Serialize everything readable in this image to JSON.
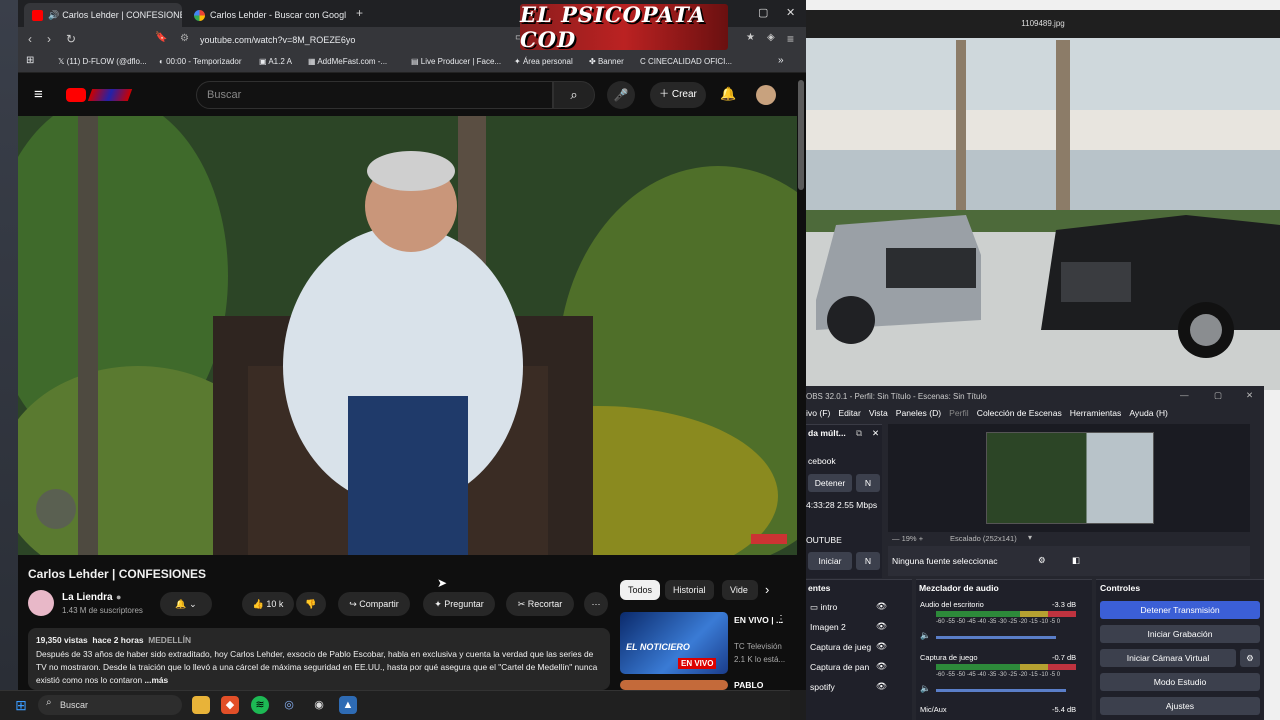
{
  "browser": {
    "tabs": [
      {
        "label": "Carlos Lehder | CONFESIONES"
      },
      {
        "label": "Carlos Lehder - Buscar con Google"
      }
    ],
    "new_tab": "+",
    "url": "youtube.com/watch?v=8M_ROEZE6yo",
    "bookmarks": [
      "(11) D-FLOW (@dflo...",
      "00:00 - Temporizador",
      "A1.2 A",
      "AddMeFast.com -...",
      "Live Producer | Face...",
      "Área personal",
      "Banner",
      "CINECALIDAD OFICI..."
    ]
  },
  "banner": {
    "text": "EL PSICOPATA COD"
  },
  "youtube": {
    "search_placeholder": "Buscar",
    "create_label": "Crear",
    "video_title": "Carlos Lehder | CONFESIONES",
    "channel_name": "La Liendra",
    "subscribers": "1.43 M de suscriptores",
    "likes": "10 k",
    "share": "Compartir",
    "ask": "Preguntar",
    "clip": "Recortar",
    "chips": [
      "Todos",
      "Historial",
      "Vide"
    ],
    "views": "19,350 vistas",
    "time_ago": "hace 2 horas",
    "location": "MEDELLÍN",
    "description": "Después de 33 años de haber sido extraditado, hoy Carlos Lehder, exsocio de Pablo Escobar, habla en exclusiva y cuenta la verdad que las series de TV no mostraron. Desde la traición que lo llevó a una cárcel de máxima seguridad en EE.UU., hasta por qué asegura que el \"Cartel de Medellín\" nunca existió como nos lo contaron",
    "more": "...más",
    "rec1": {
      "badge": "EN VIVO | ...",
      "channel": "TC Televisión",
      "views": "2.1 K lo está...",
      "thumb_text": "EL NOTICIERO",
      "live": "EN VIVO"
    },
    "rec2": {
      "title": "PABLO"
    }
  },
  "taskbar": {
    "search": "Buscar"
  },
  "viewer": {
    "title": "1109489.jpg"
  },
  "obs": {
    "title": "OBS 32.0.1 - Perfil: Sin Título - Escenas: Sin Título",
    "menu": [
      "ivo (F)",
      "Editar",
      "Vista",
      "Paneles (D)",
      "Perfil",
      "Colección de Escenas",
      "Herramientas",
      "Ayuda (H)"
    ],
    "multi_title": "da múlt...",
    "facebook": "cebook",
    "stop": "Detener",
    "m": "N",
    "stats": "4:33:28  2.55 Mbps",
    "youtube": "OUTUBE",
    "start": "Iniciar",
    "zoom": "19%",
    "scale": "Escalado (252x141)",
    "no_source": "Ninguna fuente seleccionac",
    "sources_title": "entes",
    "sources": [
      "intro",
      "Imagen 2",
      "Captura de jueg",
      "Captura de pan",
      "spotify"
    ],
    "mixer_title": "Mezclador de audio",
    "mixer": [
      {
        "name": "Audio del escritorio",
        "db": "-3.3 dB"
      },
      {
        "name": "Captura de juego",
        "db": "-0.7 dB"
      },
      {
        "name": "Mic/Aux",
        "db": "-5.4 dB"
      }
    ],
    "scale_ticks": "-60 -55 -50 -45 -40 -35 -30 -25 -20 -15 -10 -5 0",
    "controls_title": "Controles",
    "controls": [
      "Detener Transmisión",
      "Iniciar Grabación",
      "Iniciar Cámara Virtual",
      "Modo Estudio",
      "Ajustes"
    ]
  }
}
